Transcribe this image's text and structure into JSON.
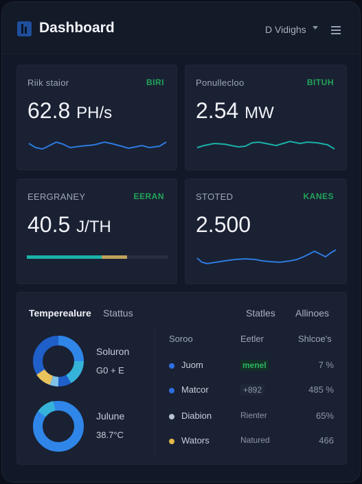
{
  "header": {
    "title": "Dashboard",
    "user": "D Vidighs"
  },
  "cards": [
    {
      "label": "Riik staior",
      "badge": "BIRI",
      "value": "62.8",
      "unit": "PH/s"
    },
    {
      "label": "Ponulleclоo",
      "badge": "BITUH",
      "value": "2.54",
      "unit": "MW"
    },
    {
      "label": "EERGRANEY",
      "badge": "EERAN",
      "value": "40.5",
      "unit": "J/TH",
      "progress_primary": 0.53,
      "progress_secondary": 0.18
    },
    {
      "label": "STOTED",
      "badge": "KANES",
      "value": "2.500",
      "unit": ""
    }
  ],
  "panel": {
    "tabs": [
      "Temperealure",
      "Stattus",
      "Statles",
      "Allinoes"
    ],
    "donuts": [
      {
        "label": "Soluron",
        "sub": "G0 + E"
      },
      {
        "label": "Julune",
        "sub": "38.7°C"
      }
    ],
    "table": {
      "headers": [
        "Sorоo",
        "Eetler",
        "Shlcoe's"
      ],
      "rows": [
        {
          "name": "Juom",
          "status": "menel",
          "share": "7 %",
          "dot": "#2f6fe0",
          "style": "green"
        },
        {
          "name": "Matcor",
          "status": "+892",
          "share": "485 %",
          "dot": "#2f6fe0",
          "style": "box"
        },
        {
          "name": "Diabion",
          "status": "Rienter",
          "share": "65%",
          "dot": "#b9c2d0",
          "style": "plain"
        },
        {
          "name": "Wators",
          "status": "Natured",
          "share": "466",
          "dot": "#e3b84a",
          "style": "plain"
        }
      ]
    }
  },
  "colors": {
    "accent": "#2d7be0",
    "teal": "#1bb1a8",
    "badge_green": "#23a55a"
  }
}
